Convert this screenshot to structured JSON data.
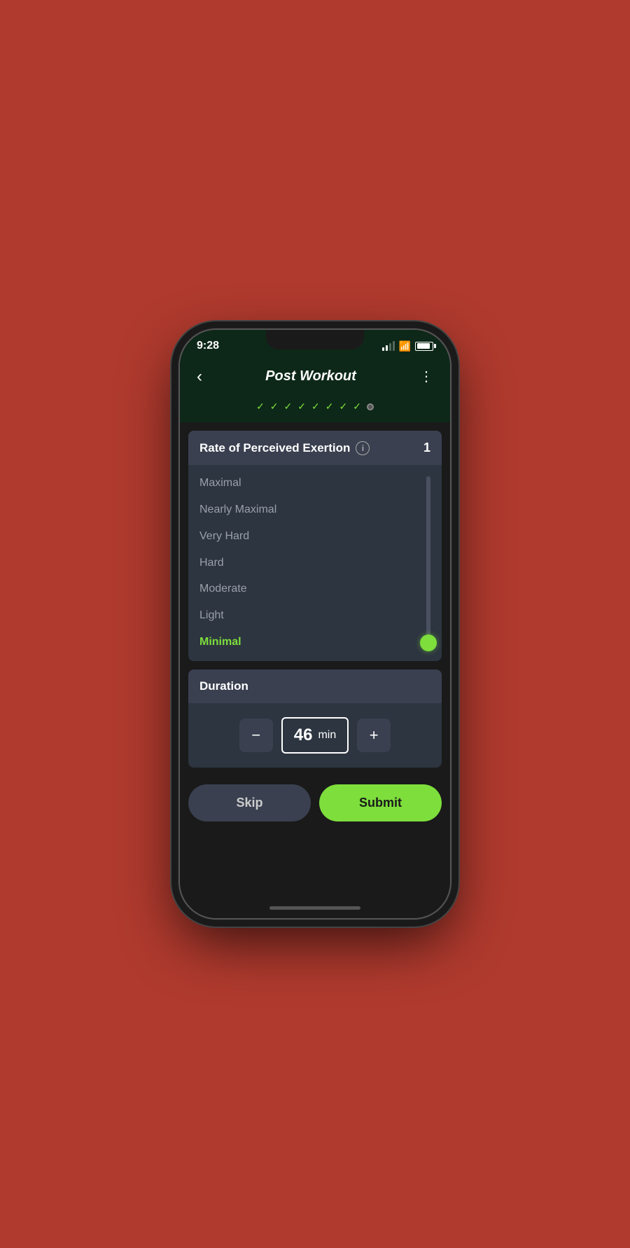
{
  "status_bar": {
    "time": "9:28",
    "battery_icon": "battery-icon",
    "wifi_icon": "wifi-icon",
    "signal_icon": "signal-icon"
  },
  "header": {
    "back_label": "‹",
    "title": "Post Workout",
    "menu_label": "⋮"
  },
  "progress": {
    "checks": [
      "✓",
      "✓",
      "✓",
      "✓",
      "✓",
      "✓",
      "✓",
      "✓"
    ],
    "current_dot": true
  },
  "rpe_card": {
    "title": "Rate of Perceived Exertion",
    "info_label": "i",
    "value": "1",
    "labels": [
      {
        "text": "Maximal",
        "active": false
      },
      {
        "text": "Nearly Maximal",
        "active": false
      },
      {
        "text": "Very Hard",
        "active": false
      },
      {
        "text": "Hard",
        "active": false
      },
      {
        "text": "Moderate",
        "active": false
      },
      {
        "text": "Light",
        "active": false
      },
      {
        "text": "Minimal",
        "active": true
      }
    ]
  },
  "duration_card": {
    "title": "Duration",
    "value": "46",
    "unit": "min",
    "minus_label": "−",
    "plus_label": "+"
  },
  "actions": {
    "skip_label": "Skip",
    "submit_label": "Submit"
  }
}
